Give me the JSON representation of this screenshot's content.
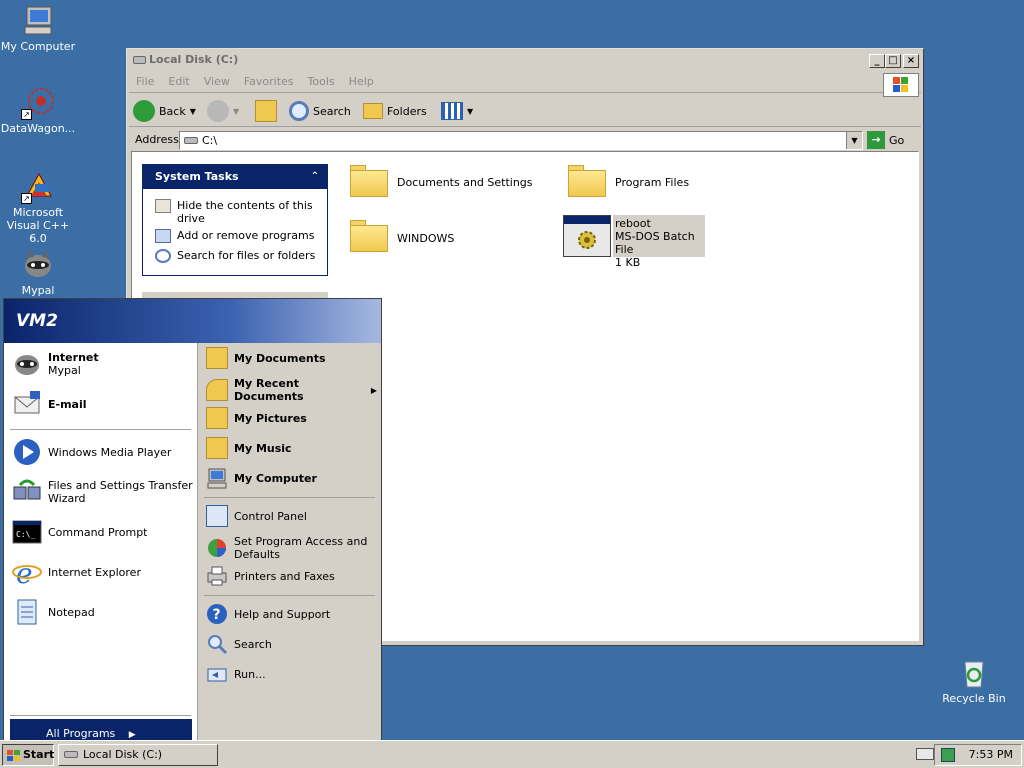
{
  "desktop": {
    "icons": [
      {
        "label": "My Computer",
        "icon": "my-computer-icon"
      },
      {
        "label": "DataWagon...",
        "icon": "datawagon-icon"
      },
      {
        "label": "Microsoft Visual C++ 6.0",
        "icon": "visual-cpp-icon"
      },
      {
        "label": "Mypal",
        "icon": "mypal-icon"
      },
      {
        "label": "Recycle Bin",
        "icon": "recycle-bin-icon"
      }
    ]
  },
  "explorer": {
    "title": "Local Disk (C:)",
    "menu": [
      "File",
      "Edit",
      "View",
      "Favorites",
      "Tools",
      "Help"
    ],
    "toolbar": {
      "back": "Back",
      "search": "Search",
      "folders": "Folders"
    },
    "address_label": "Address",
    "address_value": "C:\\",
    "go_label": "Go",
    "system_tasks": {
      "title": "System Tasks",
      "items": [
        "Hide the contents of this drive",
        "Add or remove programs",
        "Search for files or folders"
      ]
    },
    "items": [
      {
        "name": "Documents and Settings",
        "type": "folder"
      },
      {
        "name": "Program Files",
        "type": "folder"
      },
      {
        "name": "WINDOWS",
        "type": "folder"
      },
      {
        "name": "reboot",
        "detail1": "MS-DOS Batch File",
        "detail2": "1 KB",
        "type": "batch-file"
      }
    ]
  },
  "start_menu": {
    "user": "VM2",
    "pinned": [
      {
        "title": "Internet",
        "subtitle": "Mypal"
      },
      {
        "title": "E-mail"
      }
    ],
    "recent": [
      "Windows Media Player",
      "Files and Settings Transfer Wizard",
      "Command Prompt",
      "Internet Explorer",
      "Notepad"
    ],
    "all_programs": "All Programs",
    "right_bold": [
      "My Documents",
      "My Recent Documents",
      "My Pictures",
      "My Music",
      "My Computer"
    ],
    "right_group2": [
      "Control Panel",
      "Set Program Access and Defaults",
      "Printers and Faxes"
    ],
    "right_group3": [
      "Help and Support",
      "Search",
      "Run..."
    ]
  },
  "taskbar": {
    "start_label": "Start",
    "window_button": "Local Disk (C:)",
    "time": "7:53 PM"
  },
  "colors": {
    "desktop": "#3a6ea5",
    "selection": "#0a246a"
  }
}
